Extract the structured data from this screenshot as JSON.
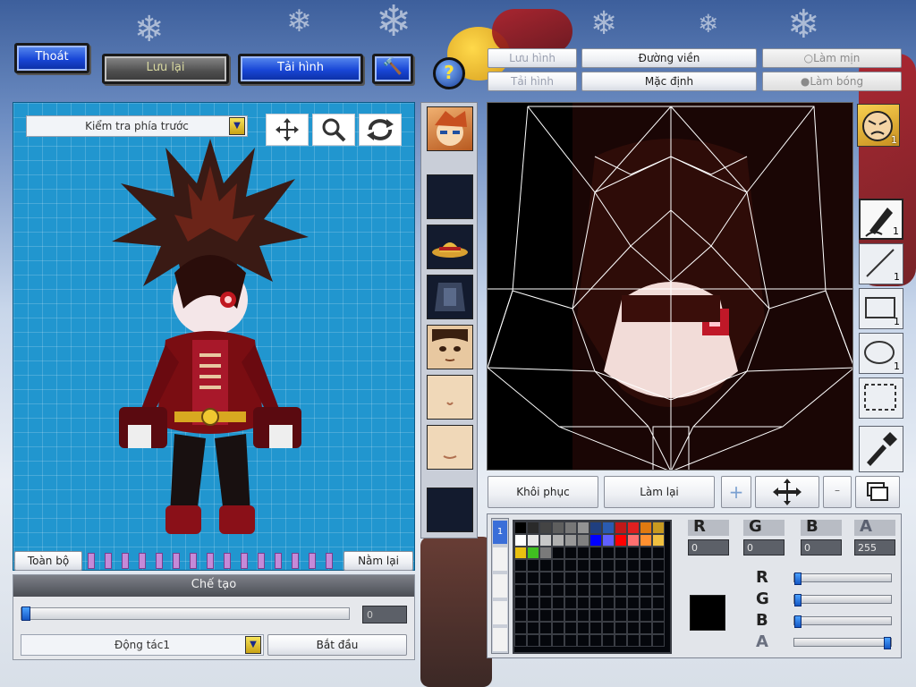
{
  "top_buttons": {
    "exit": "Thoát",
    "save": "Lưu lại",
    "reload": "Tải hình"
  },
  "editor_tabs": {
    "save_image": "Lưu hình",
    "load_image": "Tải hình",
    "outline": "Đường viền",
    "default": "Mặc định",
    "smooth": "Làm mịn",
    "shade": "Làm bóng"
  },
  "left_panel": {
    "view_select": "Kiểm tra phía trước",
    "all_button": "Toàn bộ",
    "lie_again_button": "Nằm lại",
    "craft_header": "Chế tạo",
    "progress_value": "0",
    "action_select": "Động tác1",
    "start_button": "Bắt đầu"
  },
  "face_editor": {
    "restore_button": "Khôi phục",
    "redo_button": "Làm lại"
  },
  "right_tools": [
    {
      "name": "pen",
      "count": "1"
    },
    {
      "name": "line",
      "count": "1"
    },
    {
      "name": "rectangle",
      "count": "1"
    },
    {
      "name": "ellipse",
      "count": "1"
    },
    {
      "name": "selection",
      "count": ""
    },
    {
      "name": "eyedropper",
      "count": ""
    }
  ],
  "face_badge_count": "1",
  "color": {
    "r_value": "0",
    "g_value": "0",
    "b_value": "0",
    "a_value": "255",
    "current_color": "#000000",
    "slider_levels": {
      "r": 0,
      "g": 0,
      "b": 0,
      "a": 1
    }
  },
  "palette_row1": [
    "#000000",
    "#2a2a2a",
    "#444444",
    "#5e5e5e",
    "#777777",
    "#939393",
    "#203f7f",
    "#2a5bb0",
    "#c01818",
    "#e02020",
    "#e07a10",
    "#c89a20"
  ],
  "palette_row2": [
    "#ffffff",
    "#e8e8e8",
    "#c8c8c8",
    "#b0b0b0",
    "#989898",
    "#808080",
    "#0000ff",
    "#6060ff",
    "#ff0000",
    "#ff7070",
    "#ff9030",
    "#f0c040"
  ],
  "palette_row3": [
    "#e8c010",
    "#40c020",
    "#7a7a7a"
  ]
}
